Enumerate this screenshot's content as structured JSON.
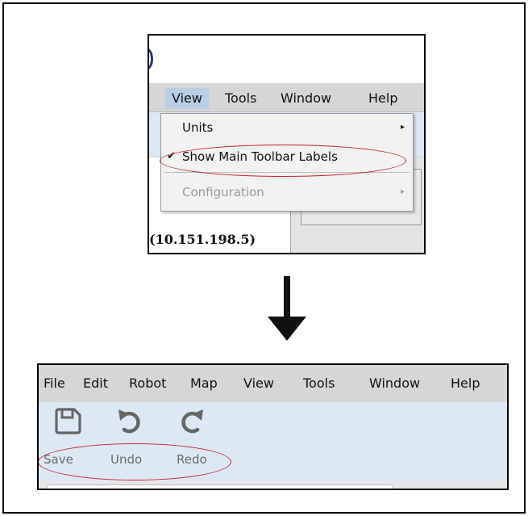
{
  "top_screenshot": {
    "menubar": [
      "View",
      "Tools",
      "Window",
      "Help"
    ],
    "active_menu": "View",
    "dropdown": {
      "items": [
        {
          "label": "Units",
          "check": "",
          "submenu_arrow": "▸",
          "disabled": false
        },
        {
          "label": "Show Main Toolbar Labels",
          "check": "✔",
          "submenu_arrow": "",
          "disabled": false
        },
        {
          "label": "Configuration",
          "check": "",
          "submenu_arrow": "▸",
          "disabled": true
        }
      ]
    },
    "ip_text": "(10.151.198.5)"
  },
  "bottom_screenshot": {
    "menubar": [
      "File",
      "Edit",
      "Robot",
      "Map",
      "View",
      "Tools",
      "Window",
      "Help"
    ],
    "toolbar": [
      {
        "label": "Save",
        "icon": "save-icon"
      },
      {
        "label": "Undo",
        "icon": "undo-icon"
      },
      {
        "label": "Redo",
        "icon": "redo-icon"
      }
    ]
  },
  "colors": {
    "highlight": "#c8202a",
    "menubar": "#d6d6d6",
    "toolbar_bg": "#dde8f5",
    "active_menu": "#b9cfe6"
  }
}
